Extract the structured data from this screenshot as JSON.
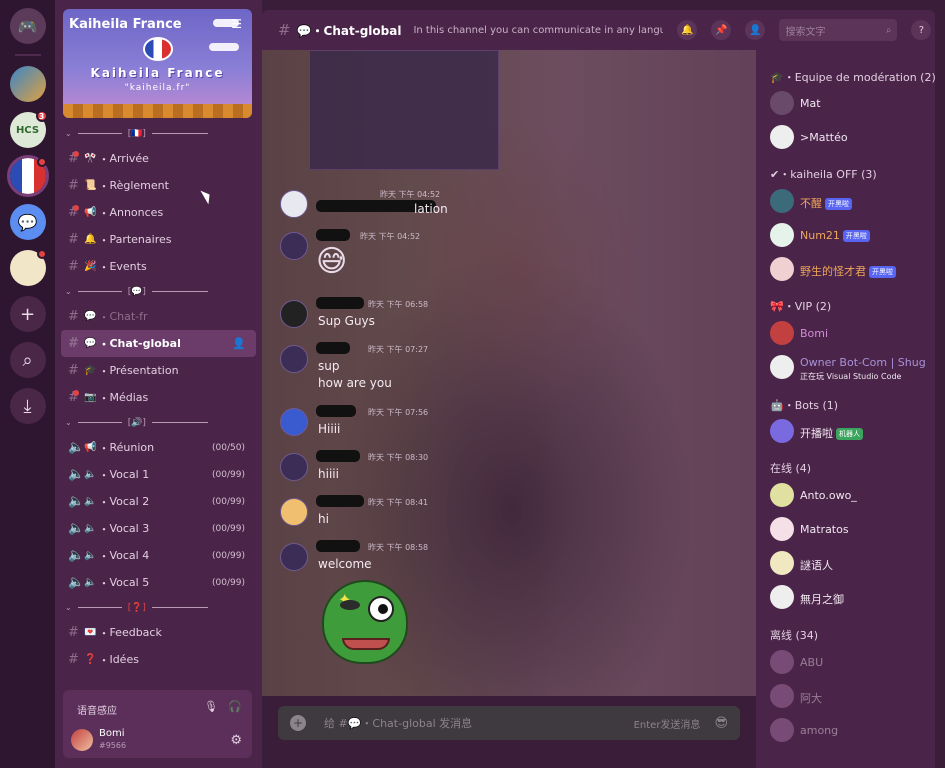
{
  "servers": [
    {
      "name": "discord-home",
      "badge": ""
    },
    {
      "name": "server-1",
      "badge": ""
    },
    {
      "name": "server-hcs",
      "label": "HCS",
      "badge": "3"
    },
    {
      "name": "server-kaiheila-france",
      "badge": "dot",
      "active": true
    },
    {
      "name": "server-discord",
      "badge": ""
    },
    {
      "name": "server-pikachu",
      "badge": "dot"
    }
  ],
  "banner": {
    "title": "Kaiheila France",
    "name": "Kaiheila France",
    "subtitle": "\"kaiheila.fr\""
  },
  "categories": {
    "cat1": "[🇫🇷]",
    "cat2": "[💬]",
    "cat3": "[🔊]",
    "cat4": "[❓]"
  },
  "channels": {
    "arrivee": "Arrivée",
    "reglement": "Règlement",
    "annonces": "Annonces",
    "partenaires": "Partenaires",
    "events": "Events",
    "chatfr": "Chat-fr",
    "chatglobal": "Chat-global",
    "presentation": "Présentation",
    "medias": "Médias",
    "reunion": "Réunion",
    "reunion_count": "(00/50)",
    "vocal1": "Vocal 1",
    "vocal2": "Vocal 2",
    "vocal3": "Vocal 3",
    "vocal4": "Vocal 4",
    "vocal5": "Vocal 5",
    "vocal_count": "(00/99)",
    "feedback": "Feedback",
    "idees": "Idées"
  },
  "user_panel": {
    "voice_label": "语音感应",
    "username": "Bomi",
    "discriminator": "#9566"
  },
  "header": {
    "channel": "Chat-global",
    "topic": "In this channel you can communicate in any langu",
    "search_placeholder": "搜索文字"
  },
  "messages": {
    "m1_ts": "昨天 下午 04:52",
    "m1_text": "lation",
    "m2_ts": "昨天 下午 04:52",
    "m3_ts": "昨天 下午 06:58",
    "m3_text": "Sup Guys",
    "m4_ts": "昨天 下午 07:27",
    "m4_line1": "sup",
    "m4_line2": "how are you",
    "m5_ts": "昨天 下午 07:56",
    "m5_text": "Hiiii",
    "m6_ts": "昨天 下午 08:30",
    "m6_text": "hiiii",
    "m7_ts": "昨天 下午 08:41",
    "m7_text": "hi",
    "m8_ts": "昨天 下午 08:58",
    "m8_text": "welcome"
  },
  "composer": {
    "placeholder": "给 #💬・Chat-global 发消息",
    "hint": "Enter发送消息"
  },
  "members": {
    "group_mod": "Equipe de modération (2)",
    "mat": "Mat",
    "matteo": ">Mattéo",
    "group_off": "kaiheila OFF (3)",
    "off1": "不醒",
    "off2": "Num21",
    "off3": "野生的怪才君",
    "tag_open": "开黑啦",
    "group_vip": "VIP (2)",
    "bomi": "Bomi",
    "owner": "Owner Bot-Com | Shug...",
    "owner_status": "正在玩 Visual Studio Code",
    "group_bots": "Bots (1)",
    "bot1": "开播啦",
    "tag_bot": "机器人",
    "group_online": "在线 (4)",
    "on1": "Anto.owo_",
    "on2": "Matratos",
    "on3": "謎语人",
    "on4": "無月之御",
    "group_offline": "离线 (34)",
    "offl1": "ABU",
    "offl2": "阿大",
    "offl3": "among"
  }
}
